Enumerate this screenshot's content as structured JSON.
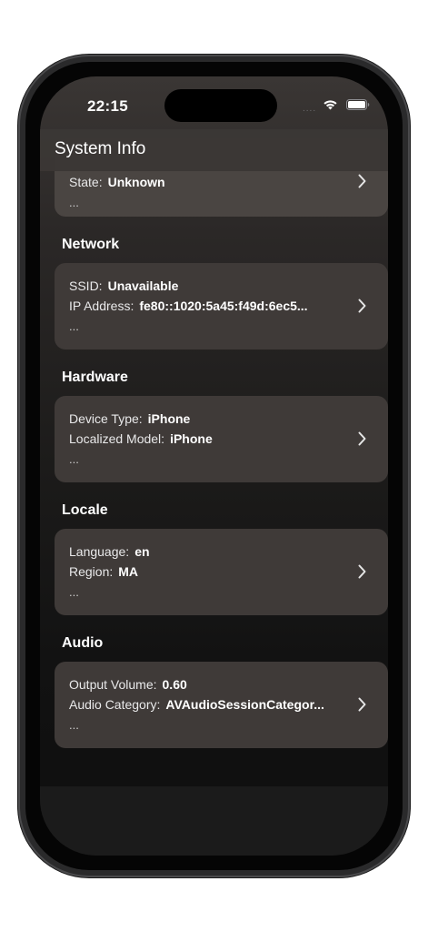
{
  "status_bar": {
    "time": "22:15",
    "signal": "....",
    "wifi_icon": "wifi-icon",
    "battery_icon": "battery-icon"
  },
  "nav": {
    "title": "System Info"
  },
  "sections": [
    {
      "header": "",
      "rows": [
        {
          "label": "State:",
          "value": "Unknown"
        }
      ],
      "more": "..."
    },
    {
      "header": "Network",
      "rows": [
        {
          "label": "SSID:",
          "value": "Unavailable"
        },
        {
          "label": "IP Address:",
          "value": "fe80::1020:5a45:f49d:6ec5..."
        }
      ],
      "more": "..."
    },
    {
      "header": "Hardware",
      "rows": [
        {
          "label": "Device Type:",
          "value": "iPhone"
        },
        {
          "label": "Localized Model:",
          "value": "iPhone"
        }
      ],
      "more": "..."
    },
    {
      "header": "Locale",
      "rows": [
        {
          "label": "Language:",
          "value": "en"
        },
        {
          "label": "Region:",
          "value": "MA"
        }
      ],
      "more": "..."
    },
    {
      "header": "Audio",
      "rows": [
        {
          "label": "Output Volume:",
          "value": "0.60"
        },
        {
          "label": "Audio Category:",
          "value": "AVAudioSessionCategor..."
        }
      ],
      "more": "..."
    }
  ],
  "colors": {
    "card": "#3f3a38",
    "background_top": "#3a3634",
    "background_bottom": "#0e0e0e",
    "text": "#ffffff"
  }
}
